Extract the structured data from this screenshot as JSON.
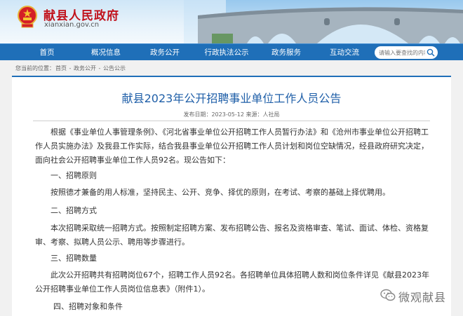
{
  "header": {
    "site_title": "献县人民政府",
    "site_domain": "xianxian.gov.cn"
  },
  "nav": {
    "items": [
      "首页",
      "概况信息",
      "政务公开",
      "行政执法公示",
      "政务服务",
      "互动交流"
    ],
    "search_placeholder": "请输入要查找的内容"
  },
  "breadcrumb": {
    "prefix": "您当前的位置：",
    "items": [
      "首页",
      "政务公开",
      "公告公示"
    ],
    "separator": " - "
  },
  "article": {
    "title": "献县2023年公开招聘事业单位工作人员公告",
    "meta": "发布日期：2023-05-12   来源：人社局",
    "paragraphs": {
      "intro": "根据《事业单位人事管理条例》、《河北省事业单位公开招聘工作人员暂行办法》和《沧州市事业单位公开招聘工作人员实施办法》及我县工作实际，结合我县事业单位公开招聘工作人员计划和岗位空缺情况，经县政府研究决定，面向社会公开招聘事业单位工作人员92名。现公告如下：",
      "h1": "一、招聘原则",
      "p1": "按照德才兼备的用人标准，坚持民主、公开、竞争、择优的原则，在考试、考察的基础上择优聘用。",
      "h2": "二、招聘方式",
      "p2": "本次招聘采取统一招聘方式。按照制定招聘方案、发布招聘公告、报名及资格审查、笔试、面试、体检、资格复审、考察、拟聘人员公示、聘用等步骤进行。",
      "h3": "三、招聘数量",
      "p3": "此次公开招聘共有招聘岗位67个，招聘工作人员92名。各招聘单位具体招聘人数和岗位条件详见《献县2023年公开招聘事业单位工作人员岗位信息表》（附件1）。",
      "h4": "四、招聘对象和条件"
    }
  },
  "watermark": {
    "text": "微观献县"
  },
  "colors": {
    "nav_bg": "#1f6fb8",
    "title_red": "#c1121c",
    "article_title_blue": "#1f5fa8"
  }
}
